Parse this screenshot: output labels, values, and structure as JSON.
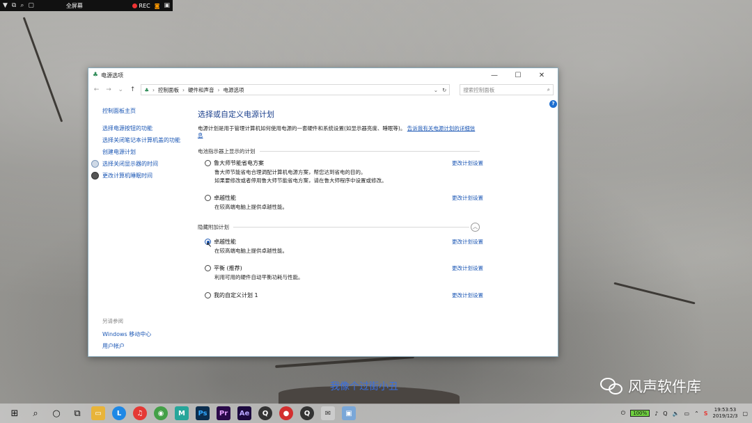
{
  "recorder": {
    "fullscreen_label": "全屏幕",
    "rec_label": "REC"
  },
  "window": {
    "title": "电源选项",
    "controls": {
      "minimize": "—",
      "maximize": "☐",
      "close": "✕"
    },
    "breadcrumb": [
      "控制面板",
      "硬件和声音",
      "电源选项"
    ],
    "search_placeholder": "搜索控制面板",
    "help_label": "?"
  },
  "sidebar": {
    "home": "控制面板主页",
    "items": [
      {
        "label": "选择电源按钮的功能"
      },
      {
        "label": "选择关闭笔记本计算机盖的功能"
      },
      {
        "label": "创建电源计划"
      },
      {
        "label": "选择关闭显示器的时间"
      },
      {
        "label": "更改计算机睡眠时间"
      }
    ],
    "see_also_heading": "另请参阅",
    "see_also": [
      {
        "label": "Windows 移动中心"
      },
      {
        "label": "用户帐户"
      }
    ]
  },
  "main": {
    "heading": "选择或自定义电源计划",
    "description": "电源计划是用于管理计算机如何使用电源的一套硬件和系统设置(如显示器亮度、睡眠等)。",
    "description_link": "告诉我有关电源计划的详细信息",
    "section_battery": "电池指示器上显示的计划",
    "section_hidden": "隐藏附加计划",
    "change_label": "更改计划设置",
    "plans_battery": [
      {
        "name": "鲁大师节能省电方案",
        "selected": false,
        "desc": [
          "鲁大师节能省电合理调配计算机电源方案，帮您达到省电的目的。",
          "如果要修改或者停用鲁大师节能省电方案，请在鲁大师程序中设置或修改。"
        ]
      },
      {
        "name": "卓越性能",
        "selected": false,
        "desc": [
          "在较高端电脑上提供卓越性能。"
        ]
      }
    ],
    "plans_hidden": [
      {
        "name": "卓越性能",
        "selected": true,
        "desc": [
          "在较高端电脑上提供卓越性能。"
        ]
      },
      {
        "name": "平衡 (推荐)",
        "selected": false,
        "desc": [
          "利用可用的硬件自动平衡功耗与性能。"
        ]
      },
      {
        "name": "我的自定义计划 1",
        "selected": false,
        "desc": []
      }
    ]
  },
  "subtitle": "我像个过街小丑",
  "watermark": "风声软件库",
  "taskbar": {
    "battery": "100%",
    "time": "19:53:53",
    "date": "2019/12/3",
    "ime": "S",
    "colors": {
      "lu": "#1e88e5",
      "netease": "#e53935",
      "chrome": "#43a047",
      "m": "#26a69a",
      "ps": "#0b2e4f",
      "pr": "#2a0a4a",
      "ae": "#1c0a3f"
    }
  }
}
